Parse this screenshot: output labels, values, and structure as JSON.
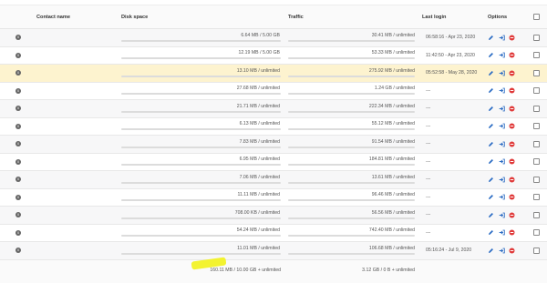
{
  "table": {
    "headers": {
      "contact_name": "Contact name",
      "disk_space": "Disk space",
      "traffic": "Traffic",
      "last_login": "Last login",
      "options": "Options"
    },
    "rows": [
      {
        "disk": "6.64 MB / 5.00 GB",
        "traffic": "30.41 MB / unlimited",
        "login": "06:58:16 - Apr 23, 2020"
      },
      {
        "disk": "12.19 MB / 5.00 GB",
        "traffic": "53.33 MB / unlimited",
        "login": "11:42:50 - Apr 23, 2020"
      },
      {
        "disk": "13.10 MB / unlimited",
        "traffic": "275.92 MB / unlimited",
        "login": "05:52:58 - May 28, 2020"
      },
      {
        "disk": "27.68 MB / unlimited",
        "traffic": "1.24 GB / unlimited",
        "login": "---"
      },
      {
        "disk": "21.71 MB / unlimited",
        "traffic": "222.34 MB / unlimited",
        "login": "---"
      },
      {
        "disk": "6.13 MB / unlimited",
        "traffic": "55.12 MB / unlimited",
        "login": "---"
      },
      {
        "disk": "7.83 MB / unlimited",
        "traffic": "91.54 MB / unlimited",
        "login": "---"
      },
      {
        "disk": "6.95 MB / unlimited",
        "traffic": "184.81 MB / unlimited",
        "login": "---"
      },
      {
        "disk": "7.06 MB / unlimited",
        "traffic": "13.61 MB / unlimited",
        "login": "---"
      },
      {
        "disk": "11.11 MB / unlimited",
        "traffic": "96.46 MB / unlimited",
        "login": "---"
      },
      {
        "disk": "708.00 KB / unlimited",
        "traffic": "56.56 MB / unlimited",
        "login": "---"
      },
      {
        "disk": "54.24 MB / unlimited",
        "traffic": "742.40 MB / unlimited",
        "login": "---"
      },
      {
        "disk": "11.01 MB / unlimited",
        "traffic": "106.68 MB / unlimited",
        "login": "05:16:24 - Jul 9, 2020"
      }
    ],
    "totals": {
      "disk": "160.11 MB / 10.00 GB + unlimited",
      "traffic": "3.12 GB / 0 B + unlimited"
    },
    "highlighted_row_index": 2
  },
  "icons": {
    "info": "i",
    "edit": "pencil-icon",
    "login": "login-arrow-icon",
    "delete": "minus-circle-icon"
  },
  "colors": {
    "highlight_row": "#fdf3cf",
    "edit_icon": "#2b6cc4",
    "login_icon": "#2b6cc4",
    "delete_icon": "#e03a3a",
    "marker": "#f2f21a"
  }
}
